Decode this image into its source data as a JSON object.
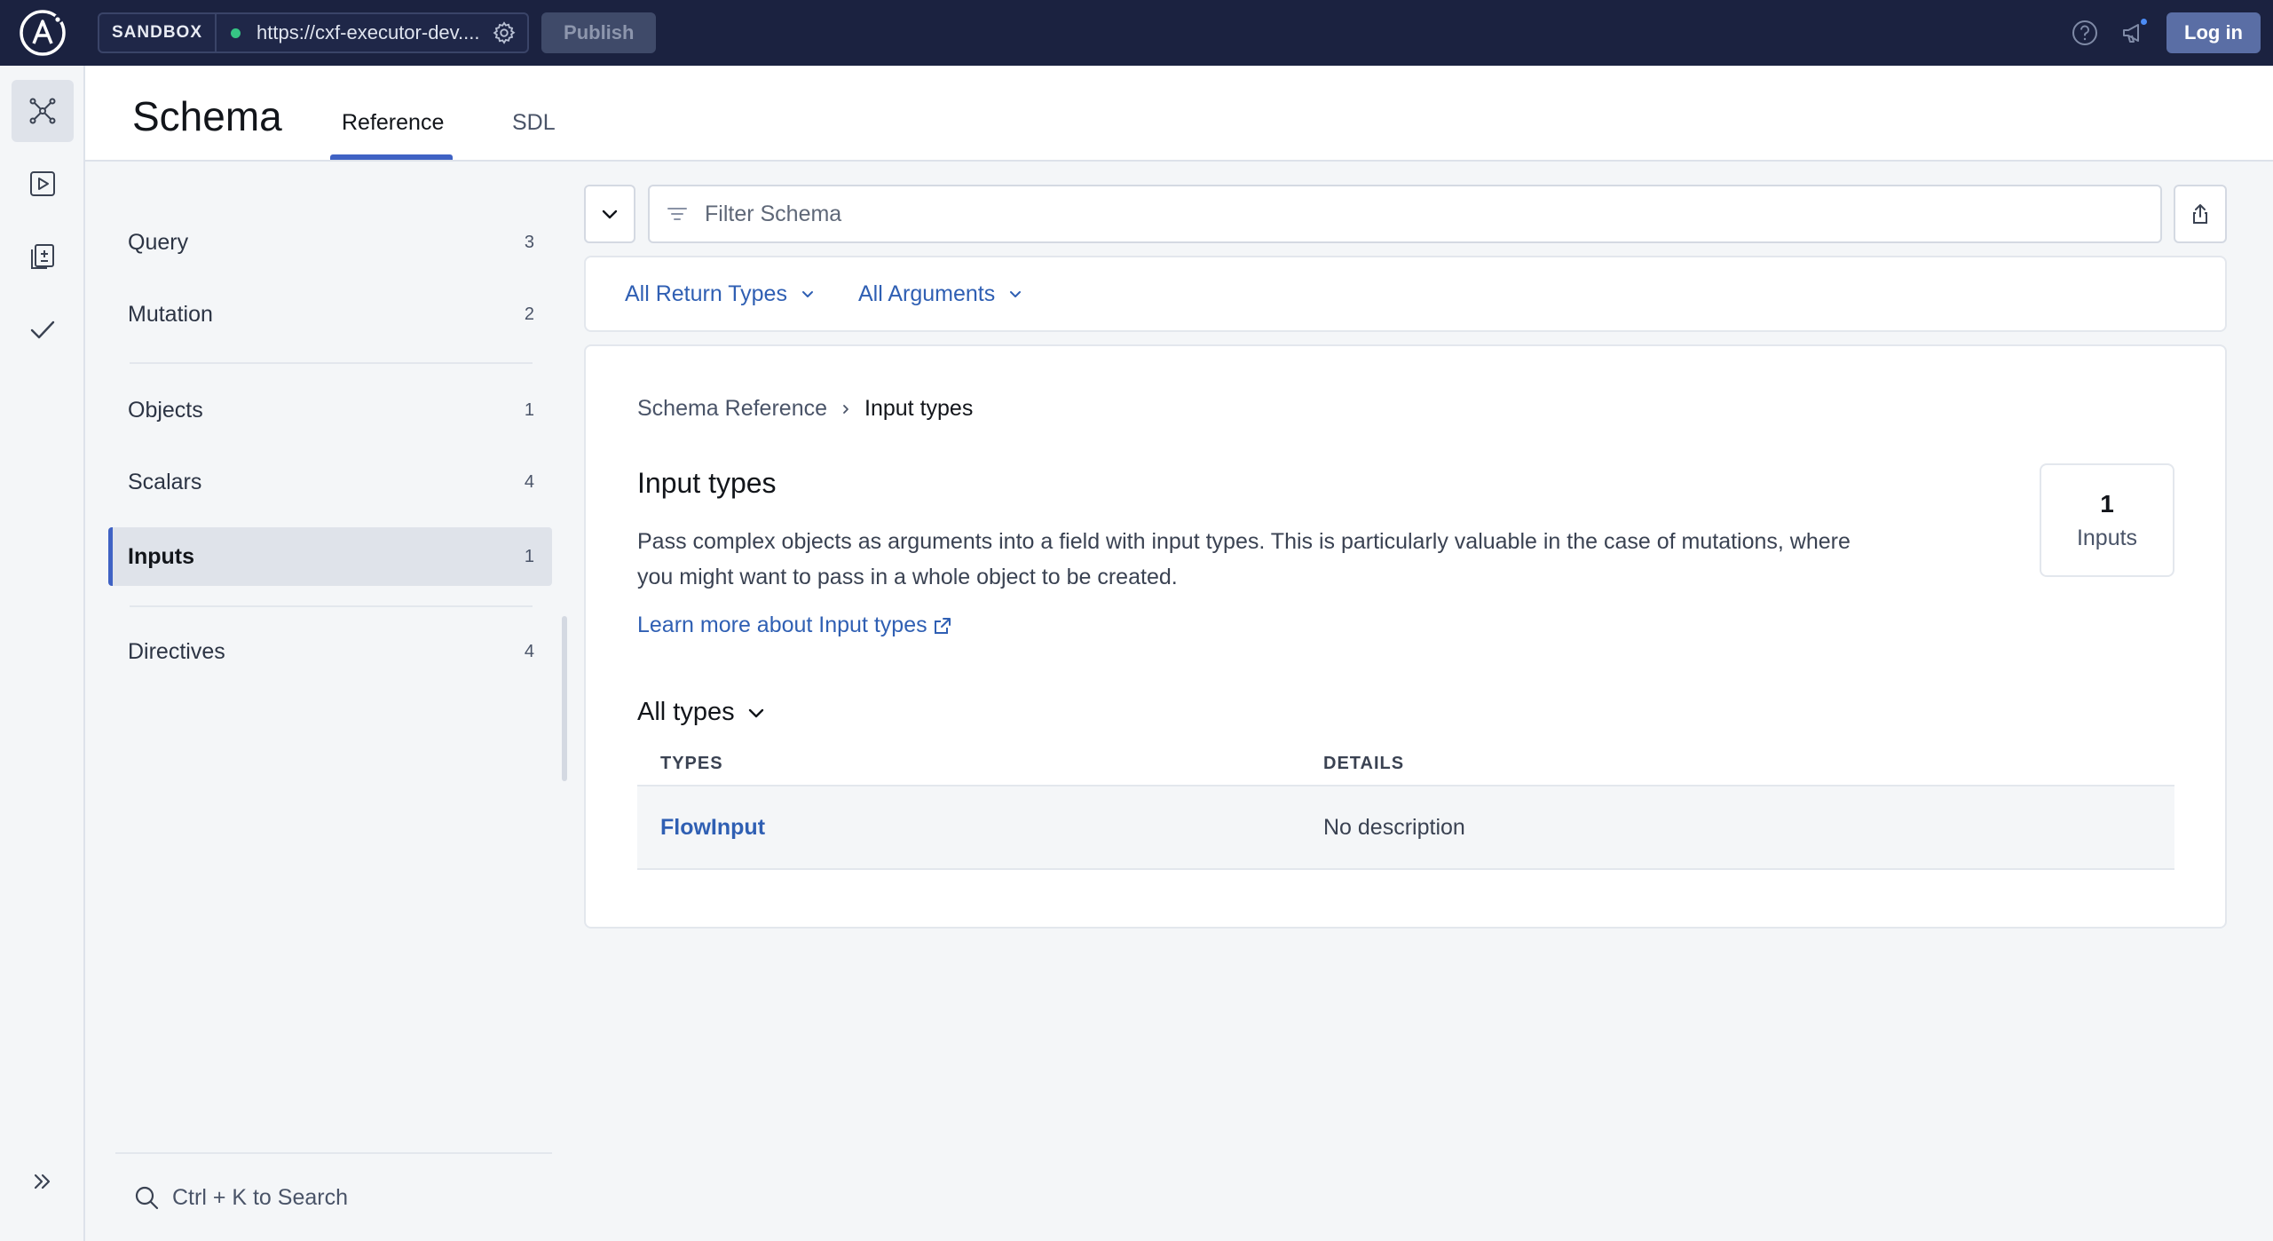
{
  "topbar": {
    "env_badge": "SANDBOX",
    "endpoint_url": "https://cxf-executor-dev....",
    "publish_label": "Publish",
    "login_label": "Log in"
  },
  "rail": {
    "items": [
      "schema-icon",
      "explorer-play-icon",
      "changelog-icon",
      "checks-icon"
    ],
    "expand_icon": "double-chevron-right-icon"
  },
  "header": {
    "title": "Schema",
    "tabs": [
      {
        "label": "Reference",
        "active": true
      },
      {
        "label": "SDL",
        "active": false
      }
    ]
  },
  "sidebar": {
    "items": [
      {
        "label": "Query",
        "count": "3"
      },
      {
        "label": "Mutation",
        "count": "2"
      },
      {
        "label": "Objects",
        "count": "1"
      },
      {
        "label": "Scalars",
        "count": "4"
      },
      {
        "label": "Inputs",
        "count": "1",
        "active": true
      },
      {
        "label": "Directives",
        "count": "4"
      }
    ],
    "search_label": "Ctrl + K to Search"
  },
  "filter": {
    "placeholder": "Filter Schema",
    "return_types_label": "All Return Types",
    "arguments_label": "All Arguments"
  },
  "content": {
    "breadcrumb": [
      "Schema Reference",
      "Input types"
    ],
    "title": "Input types",
    "description": "Pass complex objects as arguments into a field with input types. This is particularly valuable in the case of mutations, where you might want to pass in a whole object to be created.",
    "learn_more": "Learn more about Input types",
    "stat": {
      "value": "1",
      "label": "Inputs"
    },
    "all_types_label": "All types",
    "table": {
      "headers": [
        "TYPES",
        "DETAILS"
      ],
      "rows": [
        {
          "type": "FlowInput",
          "details": "No description"
        }
      ]
    }
  },
  "colors": {
    "topbar_bg": "#1b2240",
    "accent": "#3f62c4",
    "link": "#2f5fb3",
    "status_dot": "#36c584"
  }
}
